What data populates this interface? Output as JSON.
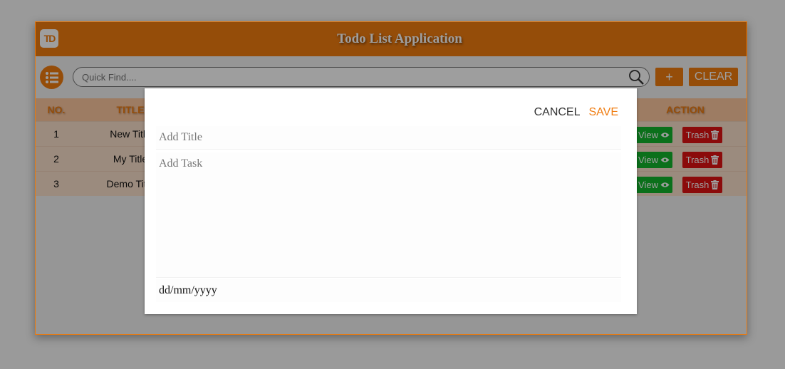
{
  "app": {
    "title": "Todo List Application",
    "logo_text": "TD"
  },
  "toolbar": {
    "menu_icon": "list-icon",
    "search_placeholder": "Quick Find....",
    "search_value": "",
    "add_label": "+",
    "clear_label": "CLEAR"
  },
  "table": {
    "headers": {
      "no": "NO.",
      "title": "TITLE",
      "action": "ACTION"
    },
    "rows": [
      {
        "no": "1",
        "title": "New Title",
        "view_label": "View",
        "trash_label": "Trash"
      },
      {
        "no": "2",
        "title": "My Title",
        "view_label": "View",
        "trash_label": "Trash"
      },
      {
        "no": "3",
        "title": "Demo Title",
        "view_label": "View",
        "trash_label": "Trash"
      }
    ]
  },
  "modal": {
    "cancel_label": "CANCEL",
    "save_label": "SAVE",
    "title_placeholder": "Add Title",
    "title_value": "",
    "task_placeholder": "Add Task",
    "task_value": "",
    "date_value": "dd/mm/yyyy"
  },
  "colors": {
    "accent": "#f07c10",
    "view": "#13b52d",
    "trash": "#e01212"
  }
}
